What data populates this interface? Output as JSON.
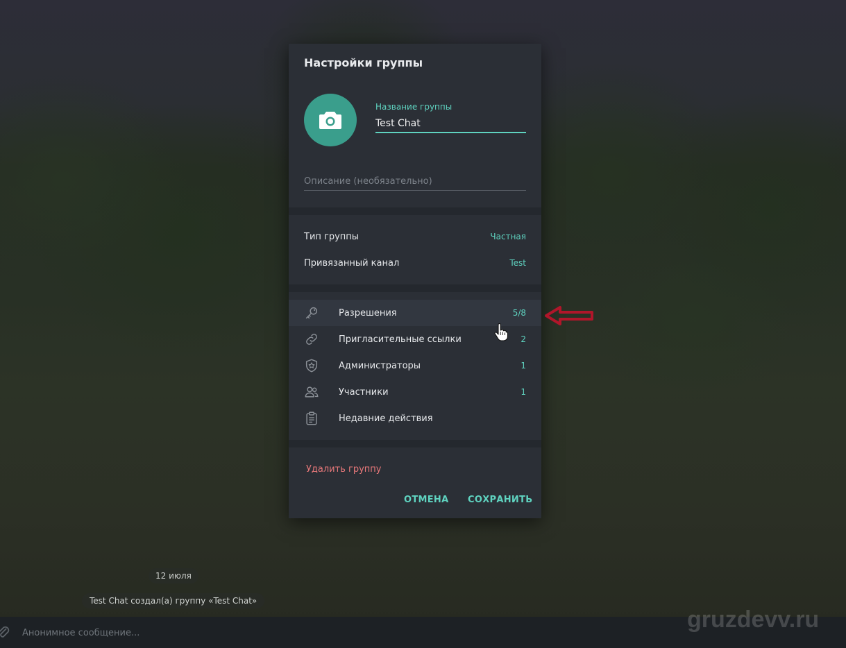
{
  "dialog": {
    "title": "Настройки группы",
    "name_label": "Название группы",
    "name_value": "Test Chat",
    "description_placeholder": "Описание (необязательно)",
    "info_rows": [
      {
        "label": "Тип группы",
        "value": "Частная"
      },
      {
        "label": "Привязанный канал",
        "value": "Test"
      }
    ],
    "menu_rows": [
      {
        "icon": "key-icon",
        "label": "Разрешения",
        "value": "5/8"
      },
      {
        "icon": "link-icon",
        "label": "Пригласительные ссылки",
        "value": "2"
      },
      {
        "icon": "shield-star-icon",
        "label": "Администраторы",
        "value": "1"
      },
      {
        "icon": "users-icon",
        "label": "Участники",
        "value": "1"
      },
      {
        "icon": "clipboard-icon",
        "label": "Недавние действия",
        "value": ""
      }
    ],
    "delete_label": "Удалить группу",
    "cancel_label": "ОТМЕНА",
    "save_label": "СОХРАНИТЬ"
  },
  "chat": {
    "date_label": "12 июля",
    "service_message": "Test Chat создал(а) группу «Test Chat»",
    "composer_placeholder": "Анонимное сообщение..."
  },
  "watermark": "gruzdevv.ru",
  "colors": {
    "accent": "#5fd3c0",
    "avatar": "#3a9e8c",
    "danger": "#e8787a",
    "annotation_arrow": "#b0162a",
    "dialog_bg": "#2b2f36"
  }
}
